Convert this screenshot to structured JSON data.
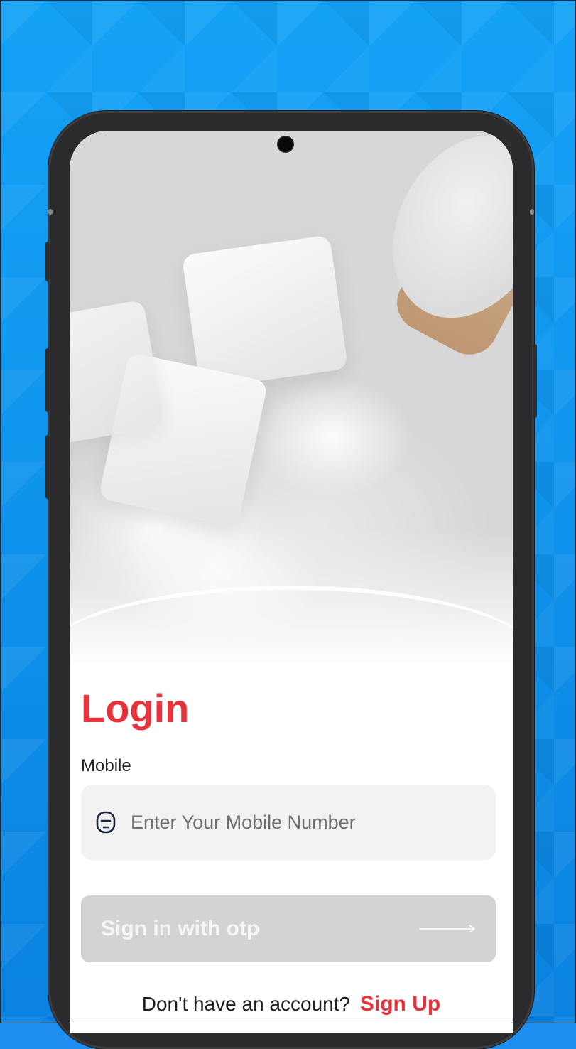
{
  "login": {
    "title": "Login",
    "mobile_label": "Mobile",
    "mobile_placeholder": "Enter Your Mobile Number",
    "otp_button_label": "Sign in with otp",
    "signup_prompt": "Don't have an account?",
    "signup_link": "Sign Up"
  },
  "icons": {
    "phone": "mobile-phone-icon",
    "arrow": "arrow-right-icon"
  },
  "colors": {
    "accent": "#e8323b",
    "button_disabled": "#d3d3d3",
    "input_bg": "#f2f2f2",
    "background": "#1e8ff0"
  }
}
